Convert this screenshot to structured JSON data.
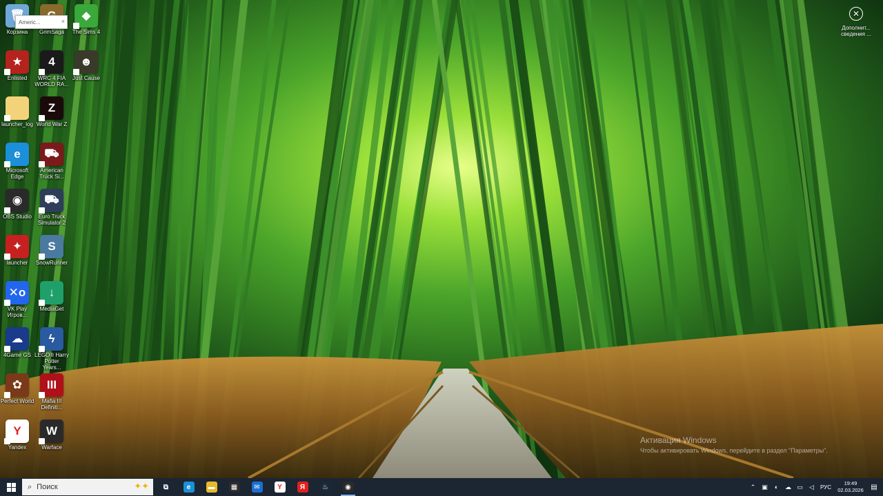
{
  "desktop": {
    "icons": [
      {
        "label": "Корзина",
        "color": "#6fa7d8",
        "glyph": "🗑",
        "icon": "recycle-bin-icon"
      },
      {
        "label": "GrimSaga",
        "color": "#8a6a2c",
        "glyph": "G",
        "icon": "grimsaga-icon"
      },
      {
        "label": "The Sims 4",
        "color": "#3aa83a",
        "glyph": "◆",
        "icon": "sims-plumbob-icon"
      },
      {
        "label": "Enlisted",
        "color": "#b4231e",
        "glyph": "★",
        "icon": "enlisted-star-icon"
      },
      {
        "label": "WRC 4 FIA WORLD RA...",
        "color": "#1a1a1a",
        "glyph": "4",
        "icon": "wrc4-icon"
      },
      {
        "label": "Just Cause",
        "color": "#3a3a2a",
        "glyph": "☻",
        "icon": "just-cause-icon"
      },
      {
        "label": "launcher_log",
        "color": "#f3d37a",
        "glyph": "",
        "icon": "text-file-icon"
      },
      {
        "label": "World War Z",
        "color": "#1a0a0a",
        "glyph": "Z",
        "icon": "world-war-z-icon"
      },
      {
        "label": "Microsoft Edge",
        "color": "#1b8fd8",
        "glyph": "e",
        "icon": "edge-icon"
      },
      {
        "label": "American Truck Si...",
        "color": "#7a1a1a",
        "glyph": "⛟",
        "icon": "american-truck-icon"
      },
      {
        "label": "OBS Studio",
        "color": "#2a2a2a",
        "glyph": "◉",
        "icon": "obs-icon"
      },
      {
        "label": "Euro Truck Simulator 2",
        "color": "#2d3d5a",
        "glyph": "⛟",
        "icon": "euro-truck-icon"
      },
      {
        "label": "launcher",
        "color": "#c62020",
        "glyph": "✦",
        "icon": "launcher-icon"
      },
      {
        "label": "SnowRunner",
        "color": "#4a7aa0",
        "glyph": "S",
        "icon": "snowrunner-icon"
      },
      {
        "label": "VK Play Игров...",
        "color": "#2266ee",
        "glyph": "✕o",
        "icon": "vk-play-icon"
      },
      {
        "label": "MediaGet",
        "color": "#1fa06a",
        "glyph": "↓",
        "icon": "mediaget-icon"
      },
      {
        "label": "4Game GS",
        "color": "#1a3a8a",
        "glyph": "☁",
        "icon": "4game-icon"
      },
      {
        "label": "LEGO® Harry Potter Years...",
        "color": "#2a5aa0",
        "glyph": "ϟ",
        "icon": "lego-harry-potter-icon"
      },
      {
        "label": "Perfect World",
        "color": "#7a3a1a",
        "glyph": "✿",
        "icon": "perfect-world-icon"
      },
      {
        "label": "Mafia III Definiti...",
        "color": "#b0101a",
        "glyph": "III",
        "icon": "mafia-icon"
      },
      {
        "label": "Yandex",
        "color": "#ffffff",
        "glyph": "Y",
        "icon": "yandex-icon"
      },
      {
        "label": "Warface",
        "color": "#2a2a2a",
        "glyph": "W",
        "icon": "warface-icon"
      }
    ],
    "tooltip": "Americ...",
    "notification": {
      "label": "Дополнит... сведения ..."
    },
    "watermark": {
      "line1": "Активация Windows",
      "line2": "Чтобы активировать Windows, перейдите в раздел \"Параметры\"."
    }
  },
  "taskbar": {
    "search_placeholder": "Поиск",
    "apps": [
      {
        "name": "task-view",
        "glyph": "⧉",
        "color": "transparent",
        "active": false
      },
      {
        "name": "edge",
        "glyph": "e",
        "color": "#1b8fd8",
        "active": false
      },
      {
        "name": "file-explorer",
        "glyph": "▬",
        "color": "#e8b92a",
        "active": false
      },
      {
        "name": "microsoft-store",
        "glyph": "▦",
        "color": "#2a2a2a",
        "active": false
      },
      {
        "name": "mail",
        "glyph": "✉",
        "color": "#1a6fd0",
        "active": false
      },
      {
        "name": "yandex-browser",
        "glyph": "Y",
        "color": "#ffffff",
        "active": false
      },
      {
        "name": "yandex",
        "glyph": "Я",
        "color": "#e02020",
        "active": false
      },
      {
        "name": "steam",
        "glyph": "♨",
        "color": "#1b2838",
        "active": false
      },
      {
        "name": "obs",
        "glyph": "◉",
        "color": "#2a2a2a",
        "active": true
      }
    ],
    "tray": {
      "lang": "РУС",
      "time": "19:49",
      "date": "02.03.2026"
    }
  }
}
